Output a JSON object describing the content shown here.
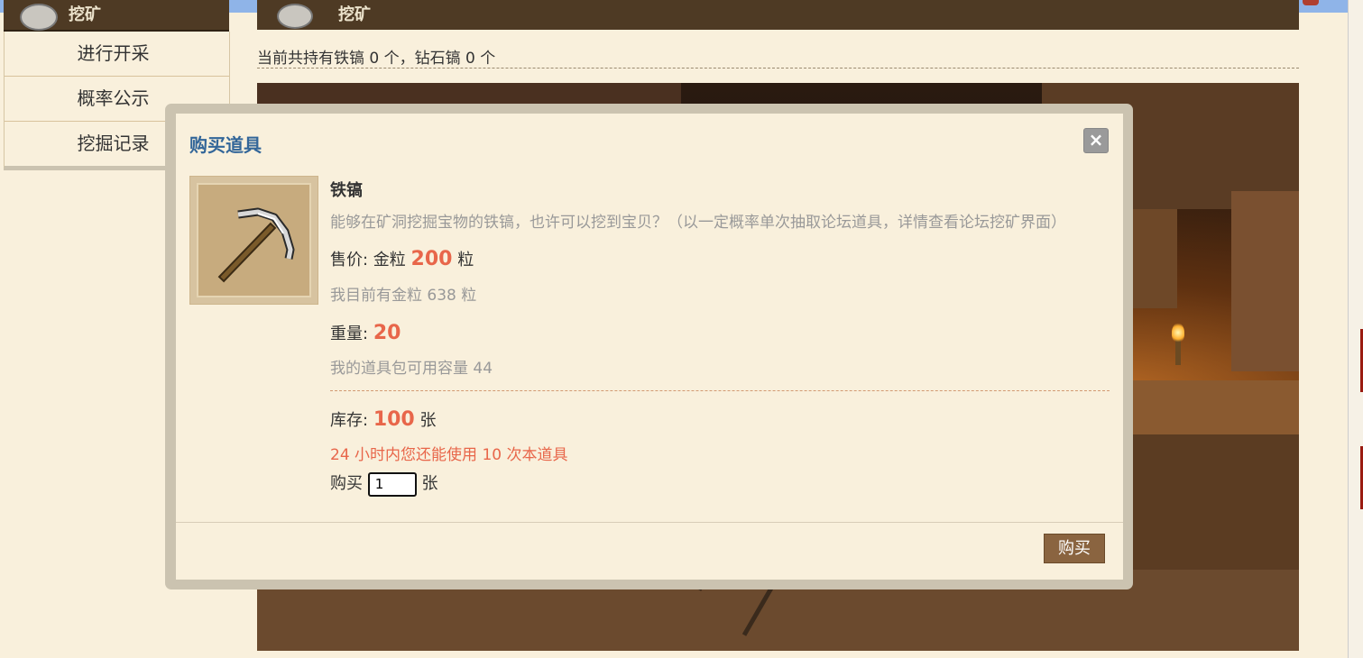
{
  "header": {
    "left_title": "挖矿",
    "main_title": "挖矿"
  },
  "sidebar": {
    "items": [
      {
        "label": "进行开采"
      },
      {
        "label": "概率公示"
      },
      {
        "label": "挖掘记录"
      }
    ]
  },
  "main": {
    "owned_text": "当前共持有铁镐 0 个，钻石镐 0 个"
  },
  "modal": {
    "title": "购买道具",
    "close_label": "×",
    "item": {
      "icon": "iron-pickaxe-icon",
      "name": "铁镐",
      "description": "能够在矿洞挖掘宝物的铁镐，也许可以挖到宝贝？（以一定概率单次抽取论坛道具，详情查看论坛挖矿界面）",
      "price_label": "售价: 金粒",
      "price_value": "200",
      "price_unit": "粒",
      "my_gold": "我目前有金粒 638 粒",
      "weight_label": "重量:",
      "weight_value": "20",
      "bag_capacity": "我的道具包可用容量 44",
      "stock_label": "库存:",
      "stock_value": "100",
      "stock_unit": "张",
      "daily_limit": "24 小时内您还能使用 10 次本道具",
      "buy_label": "购买",
      "buy_quantity": "1",
      "buy_unit": "张"
    },
    "buy_button": "购买"
  },
  "colors": {
    "accent_title": "#336699",
    "highlight": "#e8664a",
    "button": "#8a6440",
    "header_bg": "#4e3a24",
    "page_bg": "#f9f0dc"
  }
}
